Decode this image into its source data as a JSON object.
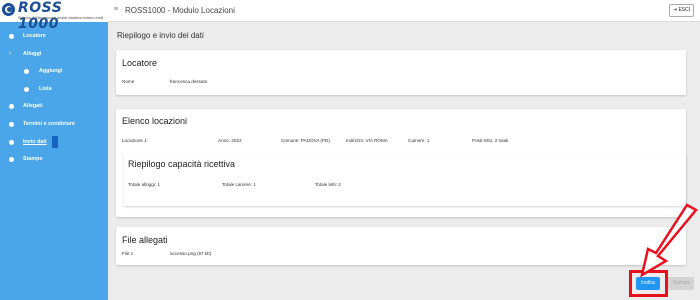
{
  "logo": {
    "text": "ROSS 1000",
    "subtitle": "Sistema di Rilevazione e analisi statistica turismo rivelli"
  },
  "header": {
    "title": "ROSS1000 - Modulo Locazioni",
    "menu_icon": "hamburger-icon",
    "exit_label": "⇥ ESCI"
  },
  "sidebar": {
    "items": [
      {
        "label": "Locatore",
        "icon": "bullet"
      },
      {
        "label": "Alloggi",
        "icon": "chevron-right-icon"
      },
      {
        "label": "Aggiungi",
        "icon": "bullet"
      },
      {
        "label": "Lista",
        "icon": "bullet"
      },
      {
        "label": "Allegati",
        "icon": "bullet"
      },
      {
        "label": "Termini e condizioni",
        "icon": "bullet"
      },
      {
        "label": "Invio dati",
        "icon": "bullet"
      },
      {
        "label": "Stampe",
        "icon": "bullet"
      }
    ]
  },
  "page": {
    "title": "Riepilogo e invio dei dati"
  },
  "locatore": {
    "title": "Locatore",
    "name_label": "Nome",
    "name_value": "francesca dessato"
  },
  "locazioni": {
    "title": "Elenco locazioni",
    "row": {
      "name": "Locazione 1",
      "anno": "Anno: 2022",
      "comune": "Comune: PADOVA (PD)",
      "indirizzo": "Indirizzo: VIA ROMA",
      "camere": "Camere: 1",
      "posti": "Posti letto: 2 totali"
    }
  },
  "riepilogo": {
    "title": "Riepilogo capacità ricettiva",
    "alloggi": "Totale alloggi: 1",
    "camere": "Totale camere: 1",
    "letti": "Totale letti: 2"
  },
  "allegati": {
    "title": "File allegati",
    "file_label": "File 1",
    "file_value": "accesso.png (67 kb)"
  },
  "actions": {
    "inoltra": "Inoltra",
    "stampa": "Stampa"
  },
  "colors": {
    "sidebar": "#4aa6e8",
    "primary": "#2196f3",
    "annotation": "#e8101d"
  }
}
